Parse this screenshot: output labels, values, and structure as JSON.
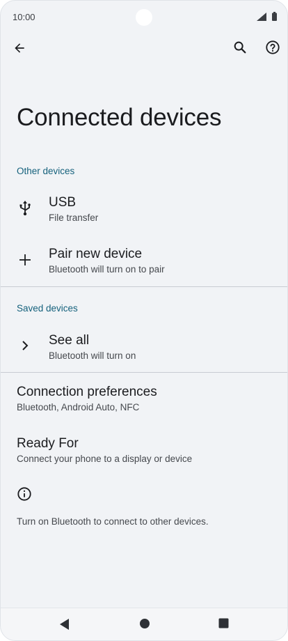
{
  "status_bar": {
    "time": "10:00"
  },
  "page": {
    "title": "Connected devices"
  },
  "sections": {
    "other_devices": {
      "header": "Other devices",
      "usb": {
        "title": "USB",
        "subtitle": "File transfer"
      },
      "pair_new": {
        "title": "Pair new device",
        "subtitle": "Bluetooth will turn on to pair"
      }
    },
    "saved_devices": {
      "header": "Saved devices",
      "see_all": {
        "title": "See all",
        "subtitle": "Bluetooth will turn on"
      }
    }
  },
  "connection_preferences": {
    "title": "Connection preferences",
    "subtitle": "Bluetooth, Android Auto, NFC"
  },
  "ready_for": {
    "title": "Ready For",
    "subtitle": "Connect your phone to a display or device"
  },
  "footer_info": {
    "text": "Turn on Bluetooth to connect to other devices."
  },
  "icons": {
    "back": "arrow-left",
    "search": "magnifier",
    "help": "question-circle",
    "usb": "usb",
    "add": "plus",
    "chevron": "chevron-right",
    "info": "info-circle"
  },
  "colors": {
    "accent": "#15617c",
    "background": "#f1f3f6",
    "text": "#1b1c1f"
  }
}
